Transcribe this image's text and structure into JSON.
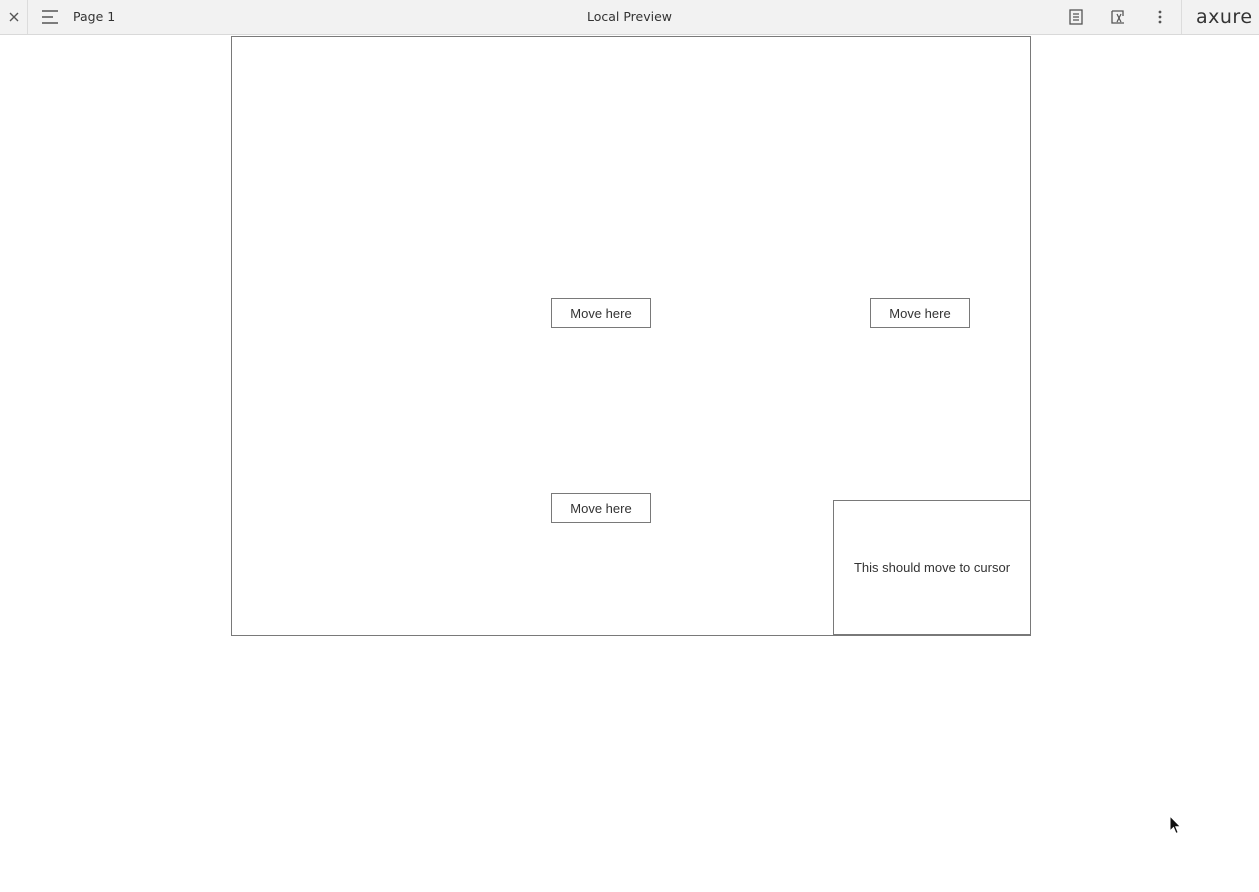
{
  "toolbar": {
    "page_name": "Page 1",
    "title": "Local Preview",
    "logo": "axure",
    "icons": {
      "close": "close-icon",
      "menu": "hamburger-menu-icon",
      "notes": "notes-icon",
      "variables": "variables-icon",
      "more": "more-vertical-icon"
    }
  },
  "canvas": {
    "buttons": [
      "Move here",
      "Move here",
      "Move here"
    ],
    "follower_text": "This should move to cursor"
  },
  "colors": {
    "toolbar_bg": "#f2f2f2",
    "border": "#797979",
    "text": "#333333"
  }
}
